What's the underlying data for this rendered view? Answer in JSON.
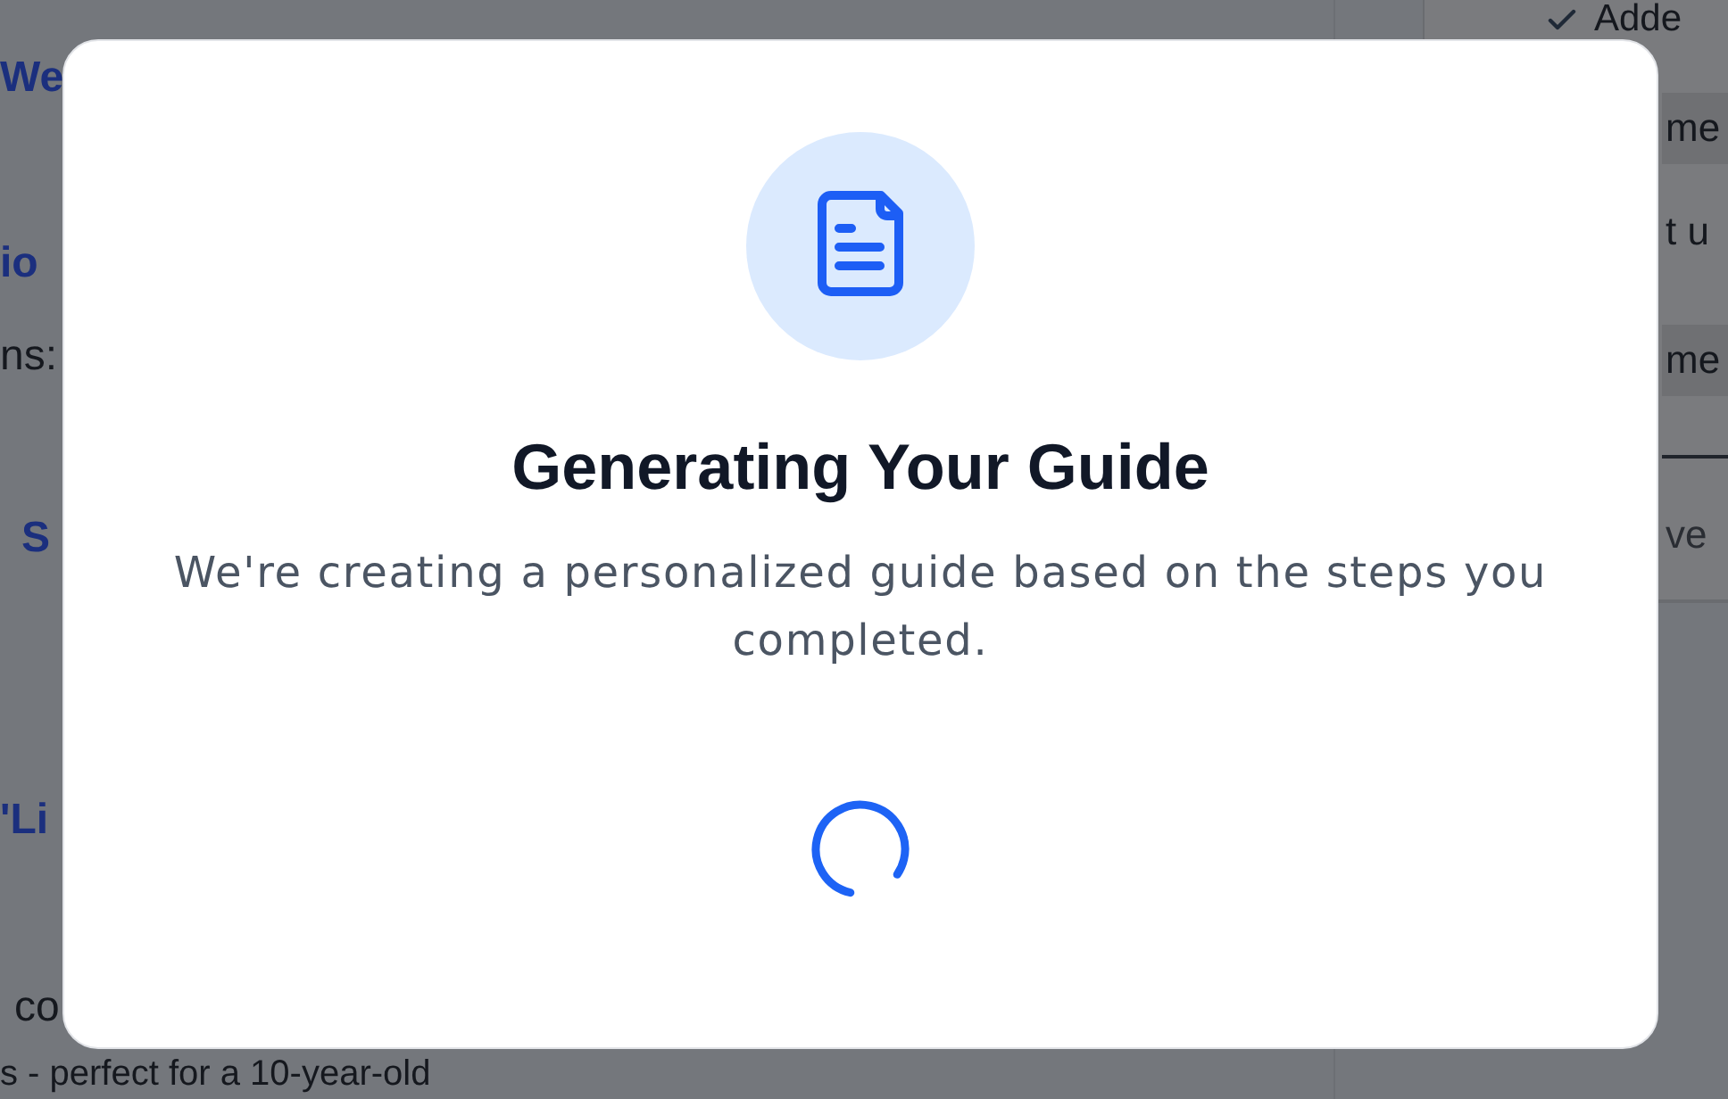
{
  "background_page": {
    "main_fragments": [
      {
        "kind": "heading",
        "text": "We"
      },
      {
        "kind": "heading",
        "text": "io"
      },
      {
        "kind": "body",
        "text": "ns:"
      },
      {
        "kind": "heading",
        "text": "S"
      },
      {
        "kind": "heading",
        "text": "'Li"
      },
      {
        "kind": "body",
        "text": "co"
      },
      {
        "kind": "body",
        "text": "s - perfect for a 10-year-old"
      }
    ],
    "side_panel": {
      "status": "Adde",
      "items": [
        {
          "kind": "tag",
          "text": "me"
        },
        {
          "kind": "text",
          "text": "t u"
        },
        {
          "kind": "tag",
          "text": "me"
        }
      ],
      "footer": "ve"
    }
  },
  "modal": {
    "title": "Generating Your Guide",
    "message": "We're creating a personalized guide based on the steps you completed."
  }
}
